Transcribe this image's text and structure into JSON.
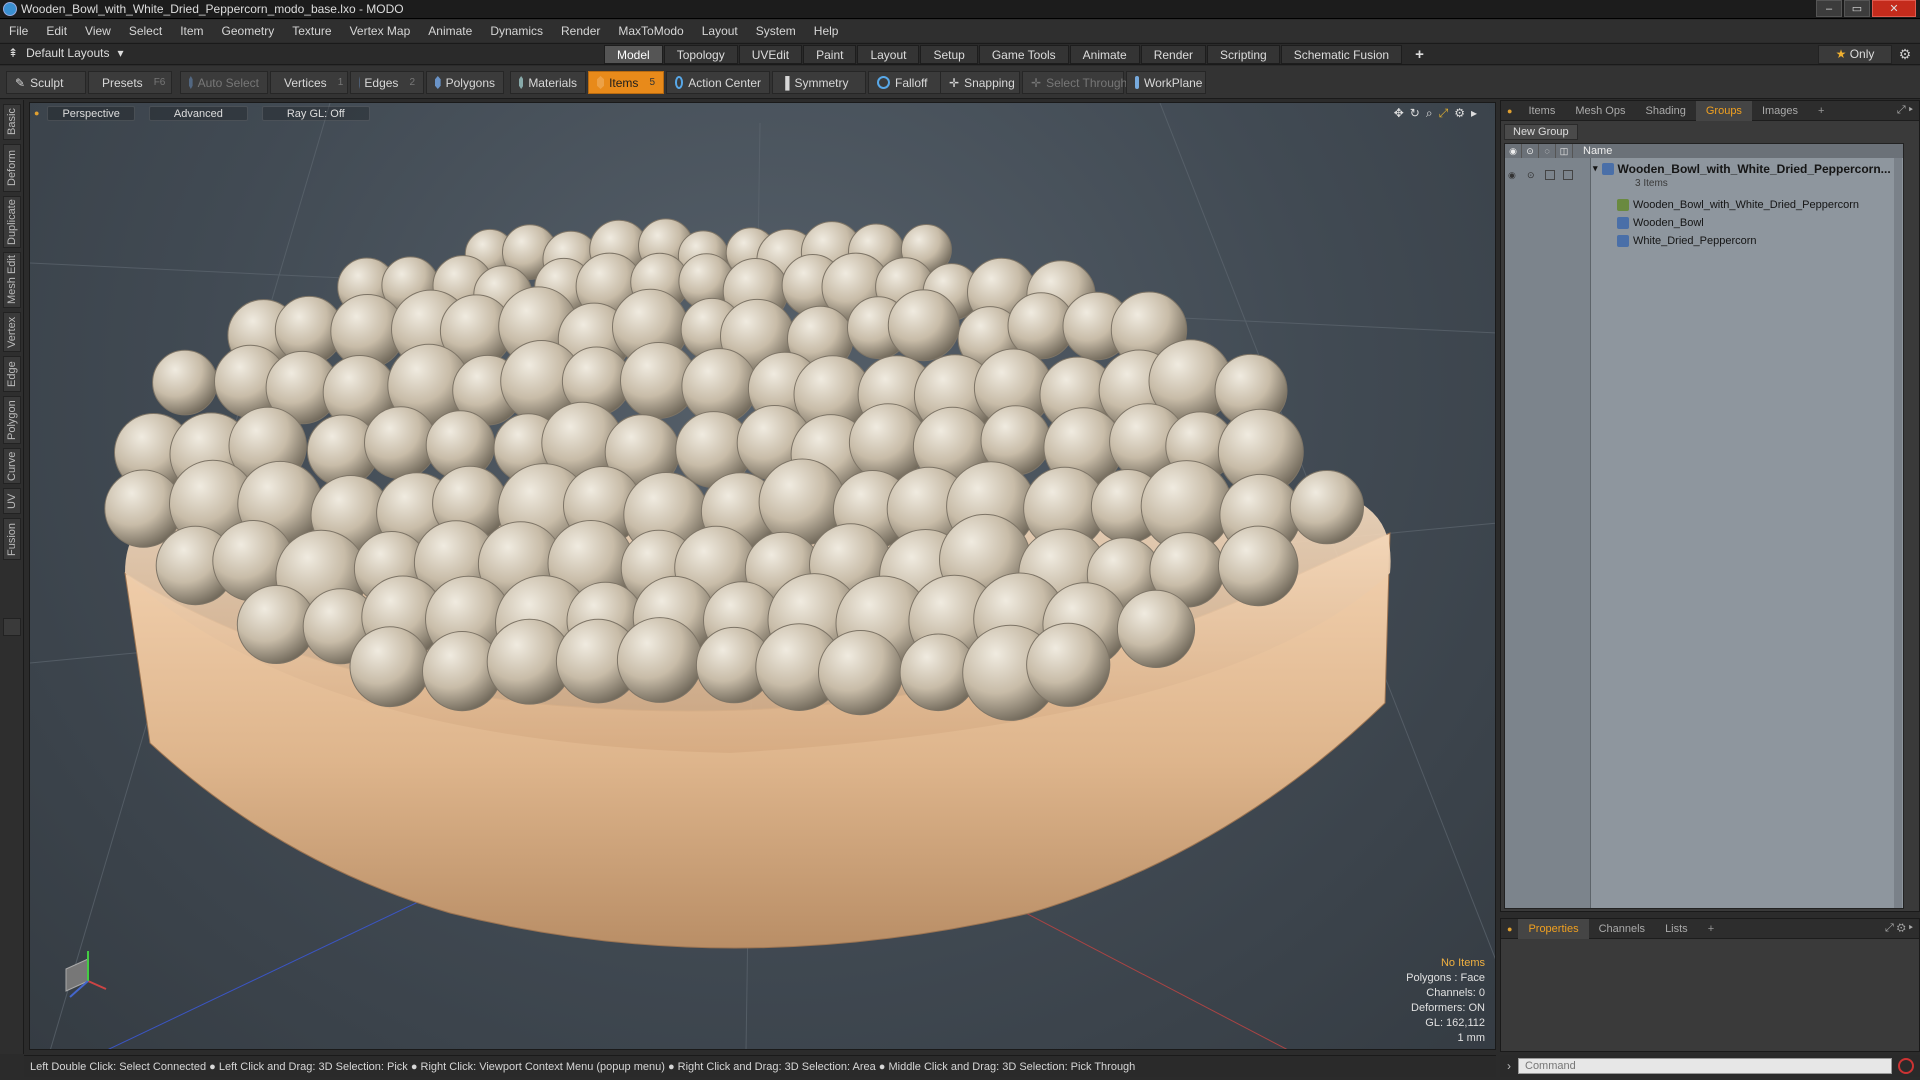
{
  "window": {
    "title": "Wooden_Bowl_with_White_Dried_Peppercorn_modo_base.lxo - MODO",
    "minimize": "–",
    "maximize": "▭",
    "close": "✕"
  },
  "menu": [
    "File",
    "Edit",
    "View",
    "Select",
    "Item",
    "Geometry",
    "Texture",
    "Vertex Map",
    "Animate",
    "Dynamics",
    "Render",
    "MaxToModo",
    "Layout",
    "System",
    "Help"
  ],
  "layout_bar": {
    "dropdown": "Default Layouts",
    "tabs": [
      "Model",
      "Topology",
      "UVEdit",
      "Paint",
      "Layout",
      "Setup",
      "Game Tools",
      "Animate",
      "Render",
      "Scripting",
      "Schematic Fusion"
    ],
    "active_tab": "Model",
    "plus": "+",
    "only": "Only"
  },
  "toolbar": {
    "sculpt": "Sculpt",
    "presets": "Presets",
    "presets_key": "F6",
    "auto_select": "Auto Select",
    "vertices": "Vertices",
    "vertices_count": "1",
    "edges": "Edges",
    "edges_count": "2",
    "polygons": "Polygons",
    "materials": "Materials",
    "items": "Items",
    "items_count": "5",
    "action_center": "Action Center",
    "symmetry": "Symmetry",
    "falloff": "Falloff",
    "snapping": "Snapping",
    "select_through": "Select Through",
    "workplane": "WorkPlane"
  },
  "left_tabs": [
    "Basic",
    "Deform",
    "Duplicate",
    "Mesh Edit",
    "Vertex",
    "Edge",
    "Polygon",
    "Curve",
    "UV",
    "Fusion"
  ],
  "viewport": {
    "perspective": "Perspective",
    "advanced": "Advanced",
    "raygl": "Ray GL: Off",
    "info": {
      "no_items": "No Items",
      "polygons": "Polygons : Face",
      "channels": "Channels: 0",
      "deformers": "Deformers: ON",
      "gl": "GL: 162,112",
      "unit": "1 mm"
    }
  },
  "status": "Left Double Click: Select Connected ● Left Click and Drag: 3D Selection: Pick ● Right Click: Viewport Context Menu (popup menu) ● Right Click and Drag: 3D Selection: Area ● Middle Click and Drag: 3D Selection: Pick Through",
  "command_placeholder": "Command",
  "right_panel": {
    "tabs": [
      "Items",
      "Mesh Ops",
      "Shading",
      "Groups",
      "Images"
    ],
    "active_tab": "Groups",
    "plus": "+",
    "new_group": "New Group",
    "name_col": "Name",
    "group_name": "Wooden_Bowl_with_White_Dried_Peppercorn...",
    "group_count": "3 Items",
    "children": [
      "Wooden_Bowl_with_White_Dried_Peppercorn",
      "Wooden_Bowl",
      "White_Dried_Peppercorn"
    ]
  },
  "bottom_panel": {
    "tabs": [
      "Properties",
      "Channels",
      "Lists"
    ],
    "active_tab": "Properties",
    "plus": "+"
  },
  "colors": {
    "accent": "#e88a1a",
    "active_tab_text": "#f0a020",
    "bowl_wood": "#e0b994",
    "peppercorn": "#c9beaa"
  }
}
